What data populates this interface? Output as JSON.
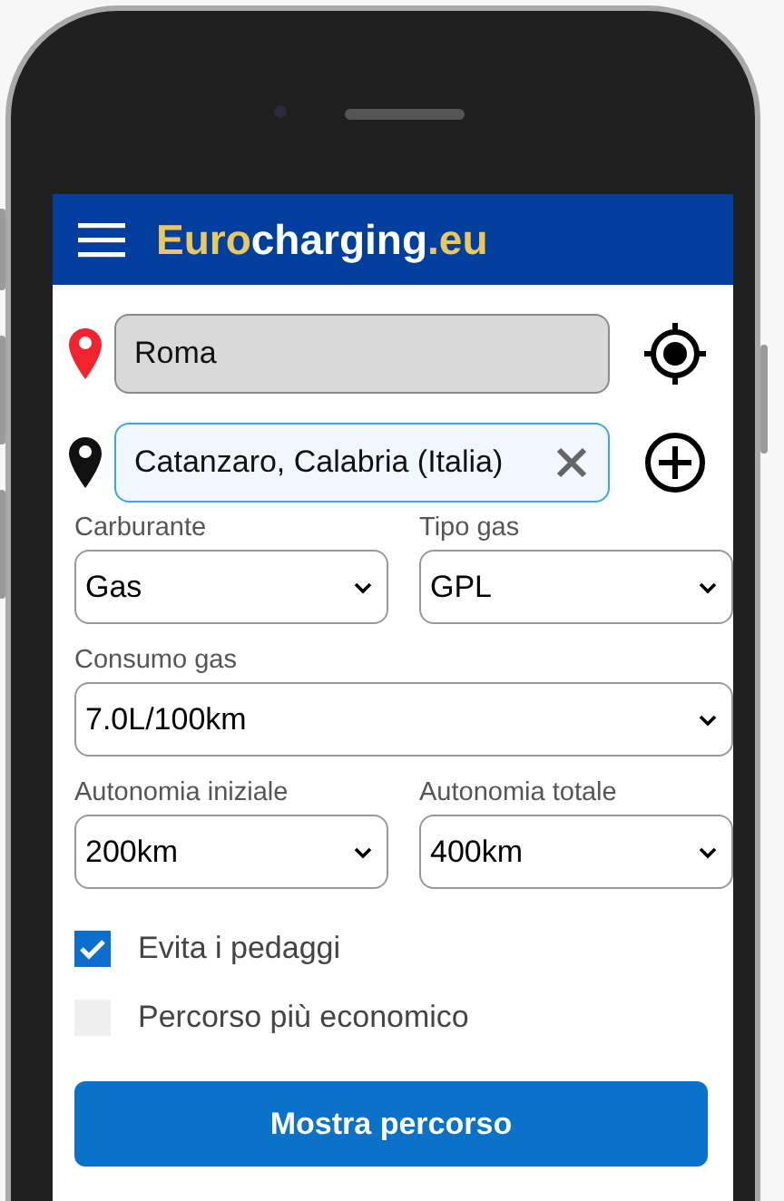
{
  "app_bar": {
    "logo": [
      {
        "text": "Euro",
        "kind": "accent"
      },
      {
        "text": "charging",
        "kind": "plain"
      },
      {
        "text": ".eu",
        "kind": "accent"
      }
    ]
  },
  "route": [
    {
      "kind": "origin",
      "value": "Roma",
      "focused": false
    },
    {
      "kind": "destination",
      "value": "Catanzaro, Calabria (Italia)",
      "focused": true
    }
  ],
  "settings": [
    [
      {
        "label": "Carburante",
        "value": "Gas"
      },
      {
        "label": "Tipo gas",
        "value": "GPL"
      }
    ],
    [
      {
        "label": "Consumo gas",
        "value": "7.0L/100km"
      }
    ],
    [
      {
        "label": "Autonomia iniziale",
        "value": "200km"
      },
      {
        "label": "Autonomia totale",
        "value": "400km"
      }
    ]
  ],
  "options": [
    {
      "label": "Evita i pedaggi",
      "checked": true
    },
    {
      "label": "Percorso più economico",
      "checked": false
    }
  ],
  "button": "Mostra percorso"
}
